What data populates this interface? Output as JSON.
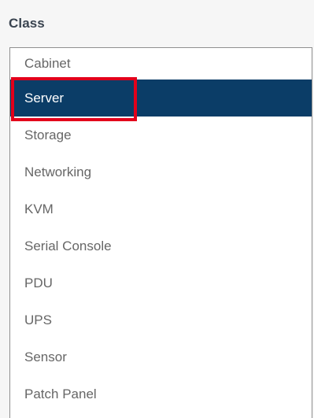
{
  "field": {
    "label": "Class",
    "options": [
      {
        "label": "Cabinet",
        "selected": false
      },
      {
        "label": "Server",
        "selected": true
      },
      {
        "label": "Storage",
        "selected": false
      },
      {
        "label": "Networking",
        "selected": false
      },
      {
        "label": "KVM",
        "selected": false
      },
      {
        "label": "Serial Console",
        "selected": false
      },
      {
        "label": "PDU",
        "selected": false
      },
      {
        "label": "UPS",
        "selected": false
      },
      {
        "label": "Sensor",
        "selected": false
      },
      {
        "label": "Patch Panel",
        "selected": false
      }
    ]
  },
  "colors": {
    "selected_background": "#0b3d67",
    "highlight_border": "#e3001b"
  }
}
